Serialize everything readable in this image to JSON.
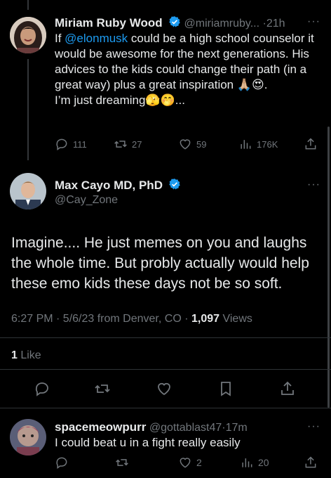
{
  "tweet1": {
    "name": "Miriam Ruby Wood",
    "handle": "@miriamruby...",
    "time": "21h",
    "text_before": "If ",
    "mention": "@elonmusk",
    "text_after": " could be a high school counselor it would be awesome for the next generations. His advices to the kids could change their path (in a great way)  plus a great inspiration 🙏🏼😍.",
    "text_line2": "I’m just dreaming🫣🤭...",
    "replies": "111",
    "reposts": "27",
    "likes": "59",
    "views": "176K"
  },
  "tweet2": {
    "name": "Max Cayo MD, PhD",
    "handle": "@Cay_Zone",
    "text": "Imagine.... He just memes on you and laughs the whole time. But probly actually would help these emo kids these days not be so soft.",
    "meta_prefix": "6:27 PM · 5/6/23 from Denver, CO · ",
    "views_count": "1,097",
    "views_label": " Views",
    "likes_count": "1",
    "likes_label": " Like"
  },
  "tweet3": {
    "name": "spacemeowpurr",
    "handle": "@gottablast47",
    "time": "17m",
    "text": "I could beat u in a fight really easily",
    "likes": "2",
    "views": "20"
  },
  "colors": {
    "accent": "#1d9bf0",
    "muted": "#71767b",
    "text": "#e7e9ea",
    "background": "#000000"
  },
  "icons": [
    "reply-icon",
    "repost-icon",
    "like-icon",
    "views-icon",
    "share-icon",
    "bookmark-icon",
    "verified-icon",
    "more-icon"
  ]
}
